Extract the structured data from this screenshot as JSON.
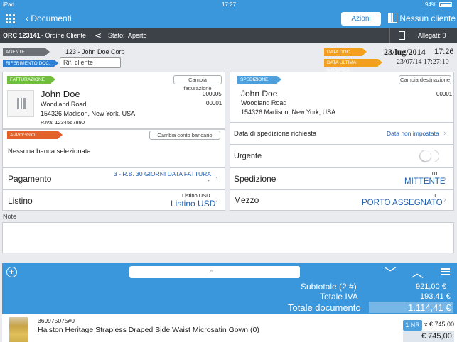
{
  "status": {
    "device": "iPad",
    "time": "17:27",
    "battery": "94%"
  },
  "nav": {
    "back": "Documenti",
    "azioni": "Azioni",
    "nessun_cliente": "Nessun cliente"
  },
  "order_bar": {
    "code": "ORC 123141",
    "type": "- Ordine Cliente",
    "stato_label": "Stato:",
    "stato": "Aperto",
    "allegati": "Allegati: 0"
  },
  "header": {
    "agente_tag": "AGENTE",
    "agente": "123 - John Doe Corp",
    "rif_tag": "RIFERIMENTO DOC.",
    "rif_placeholder": "Rif. cliente",
    "data_doc_tag": "DATA DOC.",
    "data_doc": "23/lug/2014",
    "data_doc_time": "17:26",
    "data_mod_tag": "DATA ULTIMA MODIFICA",
    "data_mod": "23/07/14 17:27:10"
  },
  "fatturazione": {
    "tag": "FATTURAZIONE",
    "button": "Cambia fatturazione",
    "name": "John Doe",
    "street": "Woodland Road",
    "city": "154326 Madison, New York, USA",
    "piva": "P.Iva: 1234567890",
    "code1": "000005",
    "code2": "00001"
  },
  "appoggio": {
    "tag": "APPOGGIO BANCARIO",
    "button": "Cambia conto bancario",
    "text": "Nessuna banca selezionata"
  },
  "pagamento": {
    "label": "Pagamento",
    "value": "3 - R.B. 30 GIORNI DATA FATTURA",
    "sub": "-"
  },
  "listino": {
    "label": "Listino",
    "small": "Listino USD",
    "value": "Listino USD"
  },
  "spedizione_addr": {
    "tag": "SPEDIZIONE",
    "button": "Cambia destinazione",
    "name": "John Doe",
    "street": "Woodland Road",
    "city": "154326 Madison, New York, USA",
    "code": "00001"
  },
  "data_sped": {
    "label": "Data di spedizione richiesta",
    "value": "Data non impostata"
  },
  "urgente": {
    "label": "Urgente"
  },
  "spedizione": {
    "label": "Spedizione",
    "small": "01",
    "value": "MITTENTE"
  },
  "mezzo": {
    "label": "Mezzo",
    "small": "1",
    "value": "PORTO ASSEGNATO"
  },
  "note": {
    "label": "Note"
  },
  "totals": {
    "subtotale_label": "Subtotale (2 #)",
    "subtotale": "921,00 €",
    "iva_label": "Totale IVA",
    "iva": "193,41 €",
    "totale_label": "Totale documento",
    "totale": "1.114,41 €"
  },
  "item": {
    "code": "369975075#0",
    "name": "Halston Heritage Strapless Draped Side Waist Microsatin Gown (0)",
    "qty": "1 NR",
    "unit_price": "x € 745,00",
    "total": "€ 745,00"
  }
}
